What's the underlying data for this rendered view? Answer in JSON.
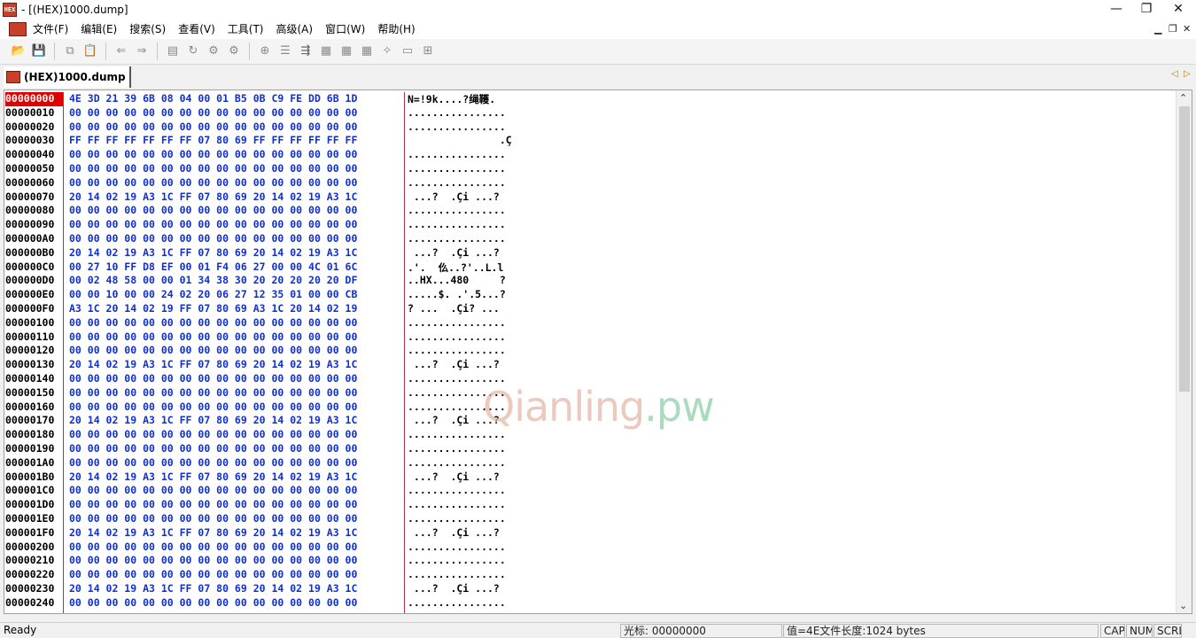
{
  "window": {
    "app_icon_text": "HEX",
    "title": "- [(HEX)1000.dump]",
    "minimize_glyph": "—",
    "maximize_glyph": "❐",
    "close_glyph": "✕"
  },
  "menubar": {
    "items": [
      "文件(F)",
      "编辑(E)",
      "搜索(S)",
      "查看(V)",
      "工具(T)",
      "高级(A)",
      "窗口(W)",
      "帮助(H)"
    ],
    "mdi_minimize": "▁",
    "mdi_restore": "❐",
    "mdi_close": "✕"
  },
  "toolbar": {
    "open_icon": "📂",
    "save_icon": "💾",
    "copy_icon": "⧉",
    "paste_icon": "📋",
    "back_icon": "⇐",
    "forward_icon": "⇒",
    "tool1_icon": "▤",
    "tool2_icon": "↻",
    "tool3_icon": "⚙",
    "tool4_icon": "⚙",
    "tool5_icon": "⊕",
    "tool6_icon": "☰",
    "tool7_icon": "⇶",
    "tool8_icon": "▦",
    "tool9_icon": "▦",
    "tool10_icon": "▦",
    "tool11_icon": "✧",
    "tool12_icon": "▭",
    "tool13_icon": "⊞"
  },
  "tabs": {
    "active_label": "(HEX)1000.dump",
    "prev_glyph": "◁",
    "next_glyph": "▷"
  },
  "hex_view": {
    "rows": [
      {
        "offset": "00000000",
        "hex": "4E 3D 21 39 6B 08 04 00 01 B5 0B C9 FE DD 6B 1D",
        "ascii": "N=!9k....?绳韄."
      },
      {
        "offset": "00000010",
        "hex": "00 00 00 00 00 00 00 00 00 00 00 00 00 00 00 00",
        "ascii": "................"
      },
      {
        "offset": "00000020",
        "hex": "00 00 00 00 00 00 00 00 00 00 00 00 00 00 00 00",
        "ascii": "................"
      },
      {
        "offset": "00000030",
        "hex": "FF FF FF FF FF FF FF 07 80 69 FF FF FF FF FF FF",
        "ascii": "               .Ç"
      },
      {
        "offset": "00000040",
        "hex": "00 00 00 00 00 00 00 00 00 00 00 00 00 00 00 00",
        "ascii": "................"
      },
      {
        "offset": "00000050",
        "hex": "00 00 00 00 00 00 00 00 00 00 00 00 00 00 00 00",
        "ascii": "................"
      },
      {
        "offset": "00000060",
        "hex": "00 00 00 00 00 00 00 00 00 00 00 00 00 00 00 00",
        "ascii": "................"
      },
      {
        "offset": "00000070",
        "hex": "20 14 02 19 A3 1C FF 07 80 69 20 14 02 19 A3 1C",
        "ascii": " ...?  .Çi ...?"
      },
      {
        "offset": "00000080",
        "hex": "00 00 00 00 00 00 00 00 00 00 00 00 00 00 00 00",
        "ascii": "................"
      },
      {
        "offset": "00000090",
        "hex": "00 00 00 00 00 00 00 00 00 00 00 00 00 00 00 00",
        "ascii": "................"
      },
      {
        "offset": "000000A0",
        "hex": "00 00 00 00 00 00 00 00 00 00 00 00 00 00 00 00",
        "ascii": "................"
      },
      {
        "offset": "000000B0",
        "hex": "20 14 02 19 A3 1C FF 07 80 69 20 14 02 19 A3 1C",
        "ascii": " ...?  .Çi ...?"
      },
      {
        "offset": "000000C0",
        "hex": "00 27 10 FF D8 EF 00 01 F4 06 27 00 00 4C 01 6C",
        "ascii": ".'.  仫..?'..L.l"
      },
      {
        "offset": "000000D0",
        "hex": "00 02 48 58 00 00 01 34 38 30 20 20 20 20 20 DF",
        "ascii": "..HX...480     ?"
      },
      {
        "offset": "000000E0",
        "hex": "00 00 10 00 00 24 02 20 06 27 12 35 01 00 00 CB",
        "ascii": ".....$. .'.5...?"
      },
      {
        "offset": "000000F0",
        "hex": "A3 1C 20 14 02 19 FF 07 80 69 A3 1C 20 14 02 19",
        "ascii": "? ...  .Çi? ..."
      },
      {
        "offset": "00000100",
        "hex": "00 00 00 00 00 00 00 00 00 00 00 00 00 00 00 00",
        "ascii": "................"
      },
      {
        "offset": "00000110",
        "hex": "00 00 00 00 00 00 00 00 00 00 00 00 00 00 00 00",
        "ascii": "................"
      },
      {
        "offset": "00000120",
        "hex": "00 00 00 00 00 00 00 00 00 00 00 00 00 00 00 00",
        "ascii": "................"
      },
      {
        "offset": "00000130",
        "hex": "20 14 02 19 A3 1C FF 07 80 69 20 14 02 19 A3 1C",
        "ascii": " ...?  .Çi ...?"
      },
      {
        "offset": "00000140",
        "hex": "00 00 00 00 00 00 00 00 00 00 00 00 00 00 00 00",
        "ascii": "................"
      },
      {
        "offset": "00000150",
        "hex": "00 00 00 00 00 00 00 00 00 00 00 00 00 00 00 00",
        "ascii": "................"
      },
      {
        "offset": "00000160",
        "hex": "00 00 00 00 00 00 00 00 00 00 00 00 00 00 00 00",
        "ascii": "................"
      },
      {
        "offset": "00000170",
        "hex": "20 14 02 19 A3 1C FF 07 80 69 20 14 02 19 A3 1C",
        "ascii": " ...?  .Çi ...?"
      },
      {
        "offset": "00000180",
        "hex": "00 00 00 00 00 00 00 00 00 00 00 00 00 00 00 00",
        "ascii": "................"
      },
      {
        "offset": "00000190",
        "hex": "00 00 00 00 00 00 00 00 00 00 00 00 00 00 00 00",
        "ascii": "................"
      },
      {
        "offset": "000001A0",
        "hex": "00 00 00 00 00 00 00 00 00 00 00 00 00 00 00 00",
        "ascii": "................"
      },
      {
        "offset": "000001B0",
        "hex": "20 14 02 19 A3 1C FF 07 80 69 20 14 02 19 A3 1C",
        "ascii": " ...?  .Çi ...?"
      },
      {
        "offset": "000001C0",
        "hex": "00 00 00 00 00 00 00 00 00 00 00 00 00 00 00 00",
        "ascii": "................"
      },
      {
        "offset": "000001D0",
        "hex": "00 00 00 00 00 00 00 00 00 00 00 00 00 00 00 00",
        "ascii": "................"
      },
      {
        "offset": "000001E0",
        "hex": "00 00 00 00 00 00 00 00 00 00 00 00 00 00 00 00",
        "ascii": "................"
      },
      {
        "offset": "000001F0",
        "hex": "20 14 02 19 A3 1C FF 07 80 69 20 14 02 19 A3 1C",
        "ascii": " ...?  .Çi ...?"
      },
      {
        "offset": "00000200",
        "hex": "00 00 00 00 00 00 00 00 00 00 00 00 00 00 00 00",
        "ascii": "................"
      },
      {
        "offset": "00000210",
        "hex": "00 00 00 00 00 00 00 00 00 00 00 00 00 00 00 00",
        "ascii": "................"
      },
      {
        "offset": "00000220",
        "hex": "00 00 00 00 00 00 00 00 00 00 00 00 00 00 00 00",
        "ascii": "................"
      },
      {
        "offset": "00000230",
        "hex": "20 14 02 19 A3 1C FF 07 80 69 20 14 02 19 A3 1C",
        "ascii": " ...?  .Çi ...?"
      },
      {
        "offset": "00000240",
        "hex": "00 00 00 00 00 00 00 00 00 00 00 00 00 00 00 00",
        "ascii": "................"
      }
    ],
    "selected_offset_index": 0
  },
  "watermark": {
    "text": "Qianling",
    "tld": ".pw"
  },
  "scrollbar": {
    "up_glyph": "⌃",
    "down_glyph": "⌄"
  },
  "statusbar": {
    "ready": "Ready",
    "cursor": "光标: 00000000",
    "value": "值=4E文件长度:1024 bytes",
    "cap": "CAP",
    "num": "NUM",
    "scrl": "SCRL"
  },
  "colors": {
    "hex_text": "#1030d0",
    "offset_selected_bg": "#e00000",
    "column_divider": "#b03050"
  }
}
